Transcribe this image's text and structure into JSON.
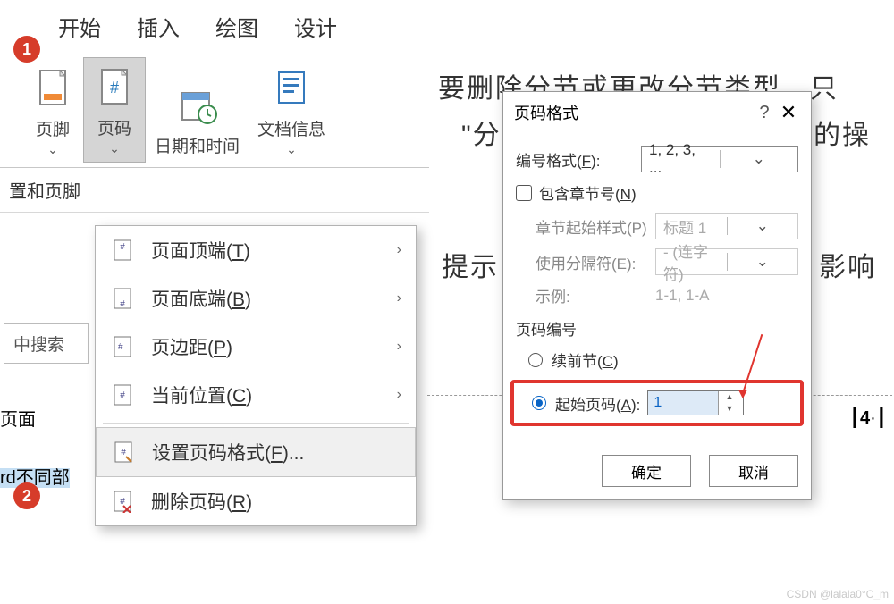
{
  "tabs": {
    "t1": "开始",
    "t2": "插入",
    "t3": "绘图",
    "t4": "设计"
  },
  "tools": {
    "footer": "页脚",
    "page_num": "页码",
    "datetime": "日期和时间",
    "doc_info": "文档信息"
  },
  "sub_label": "置和页脚",
  "search": "中搜索",
  "below": {
    "a": "页面",
    "b": "rd不同部"
  },
  "dropdown": {
    "top": "页面顶端(T)",
    "bottom": "页面底端(B)",
    "margin": "页边距(P)",
    "current": "当前位置(C)",
    "format": "设置页码格式(F)...",
    "remove": "删除页码(R)"
  },
  "bg": {
    "l1a": "要删除分节或更改分节类型，只",
    "l1b": "\"分",
    "l1c": "的操",
    "l2a": "提示",
    "l2b": "影响",
    "page_ind": "4"
  },
  "dialog": {
    "title": "页码格式",
    "num_format_label": "编号格式(F):",
    "num_format_value": "1, 2, 3, ...",
    "include_chapter": "包含章节号(N)",
    "chapter_style_label": "章节起始样式(P)",
    "chapter_style_value": "标题 1",
    "separator_label": "使用分隔符(E):",
    "separator_value": "-   (连字符)",
    "example_label": "示例:",
    "example_value": "1-1, 1-A",
    "group": "页码编号",
    "continue": "续前节(C)",
    "start_at": "起始页码(A):",
    "start_value": "1",
    "ok": "确定",
    "cancel": "取消"
  },
  "badges": {
    "b1": "1",
    "b2": "2"
  },
  "watermark": "CSDN @lalala0°C_m"
}
